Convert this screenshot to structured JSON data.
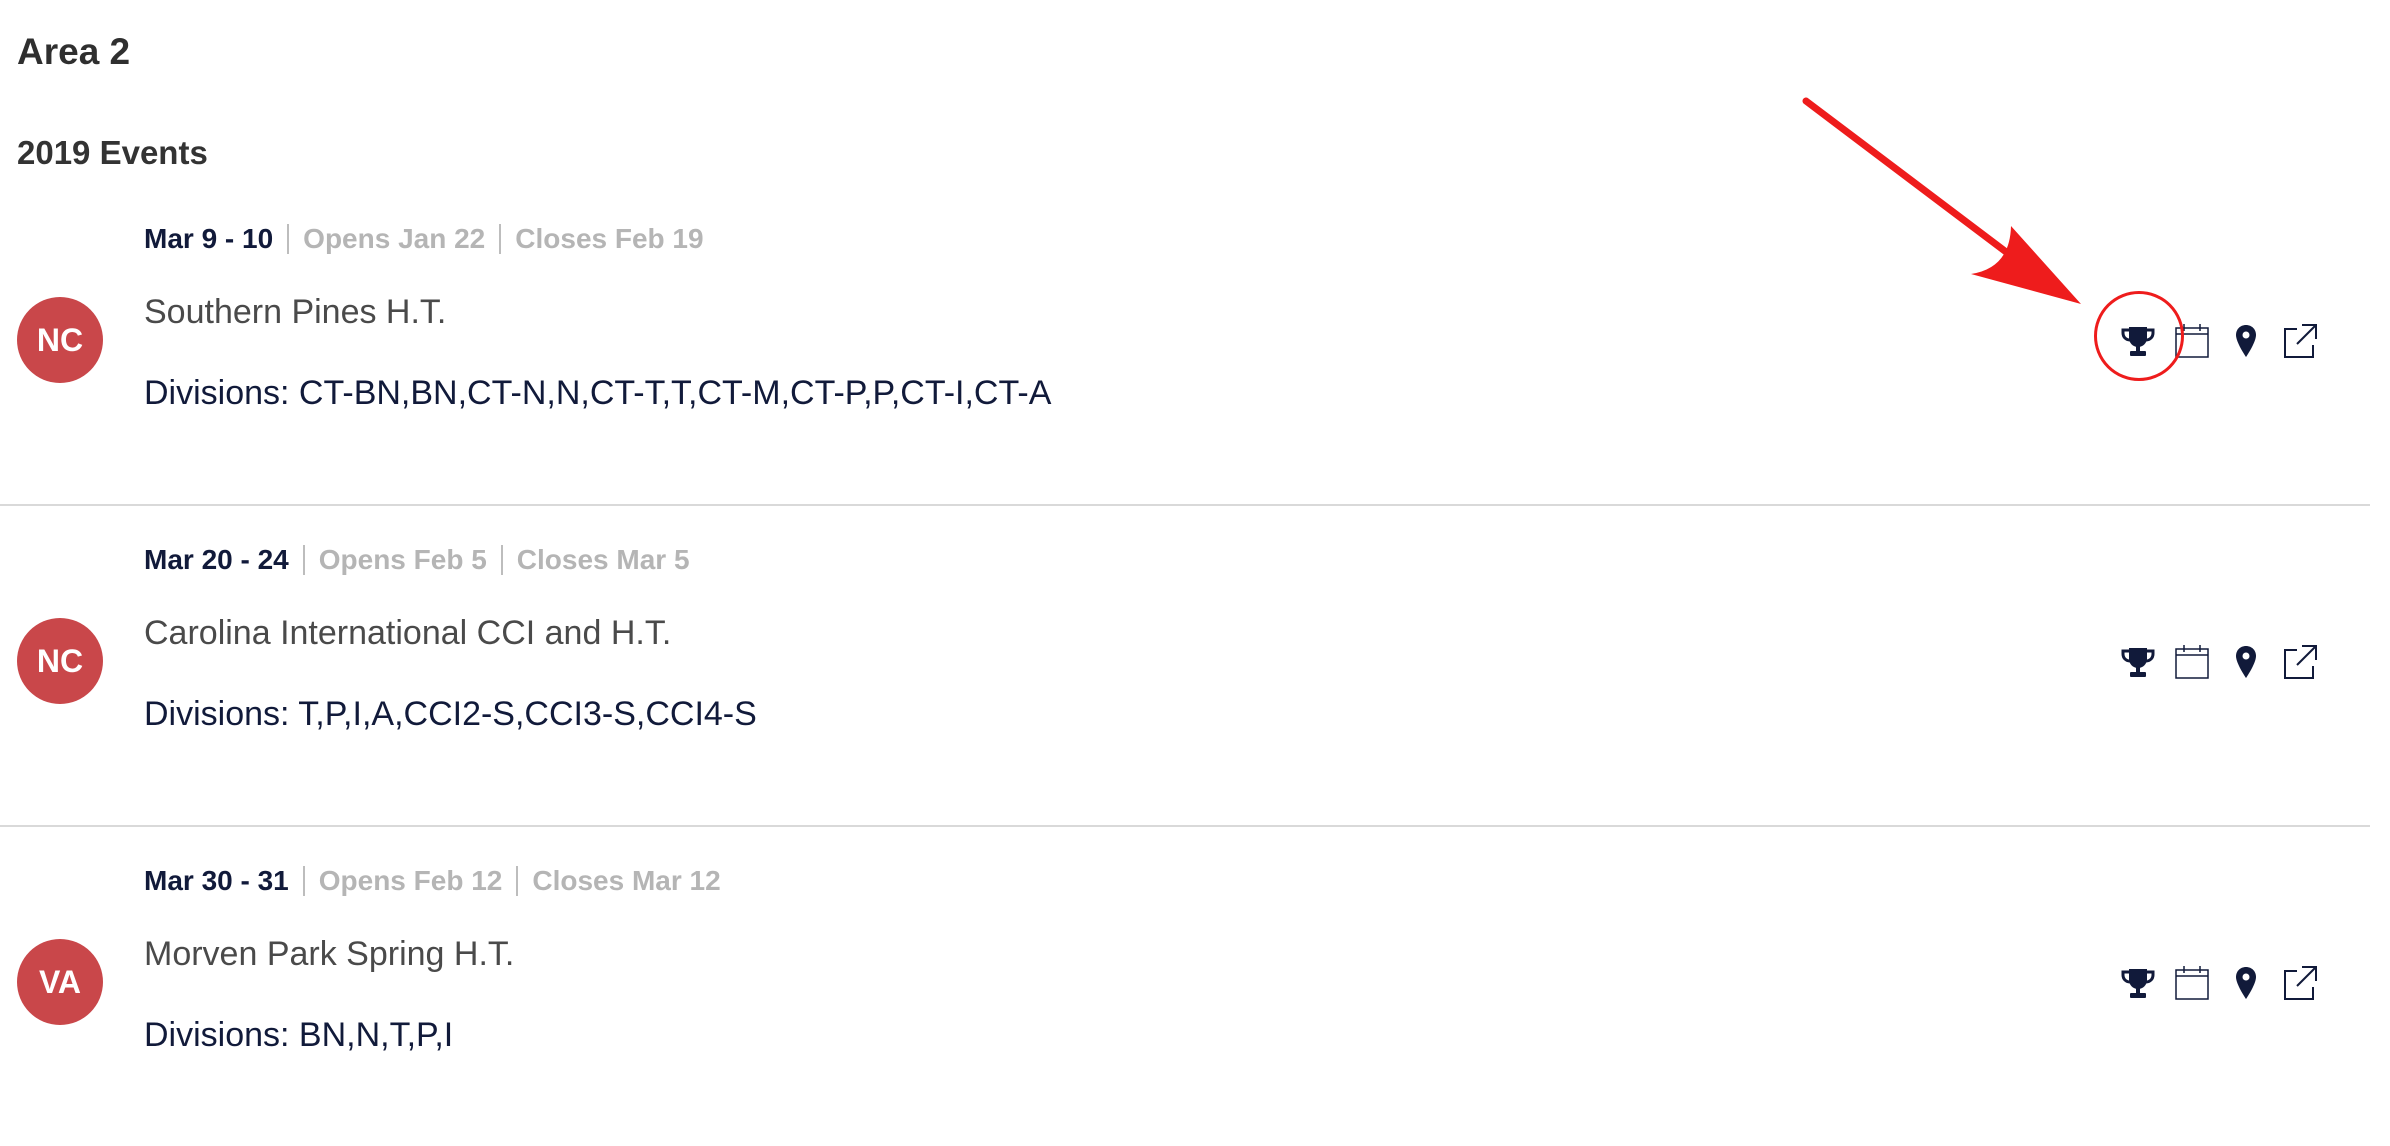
{
  "area_title": "Area 2",
  "year_heading": "2019 Events",
  "events": [
    {
      "state": "NC",
      "dates": "Mar 9 - 10",
      "opens": "Opens Jan 22",
      "closes": "Closes Feb 19",
      "name": "Southern Pines H.T.",
      "divisions": "Divisions: CT-BN,BN,CT-N,N,CT-T,T,CT-M,CT-P,P,CT-I,CT-A"
    },
    {
      "state": "NC",
      "dates": "Mar 20 - 24",
      "opens": "Opens Feb 5",
      "closes": "Closes Mar 5",
      "name": "Carolina International CCI and H.T.",
      "divisions": "Divisions: T,P,I,A,CCI2-S,CCI3-S,CCI4-S"
    },
    {
      "state": "VA",
      "dates": "Mar 30 - 31",
      "opens": "Opens Feb 12",
      "closes": "Closes Mar 12",
      "name": "Morven Park Spring H.T.",
      "divisions": "Divisions: BN,N,T,P,I"
    }
  ],
  "icons": {
    "results": "trophy-icon",
    "calendar": "calendar-icon",
    "location": "map-pin-icon",
    "website": "external-link-icon"
  },
  "colors": {
    "badge": "#c9474a",
    "navy": "#111a3a",
    "muted": "#b5b5b5",
    "annotation": "#ee1c1c"
  }
}
